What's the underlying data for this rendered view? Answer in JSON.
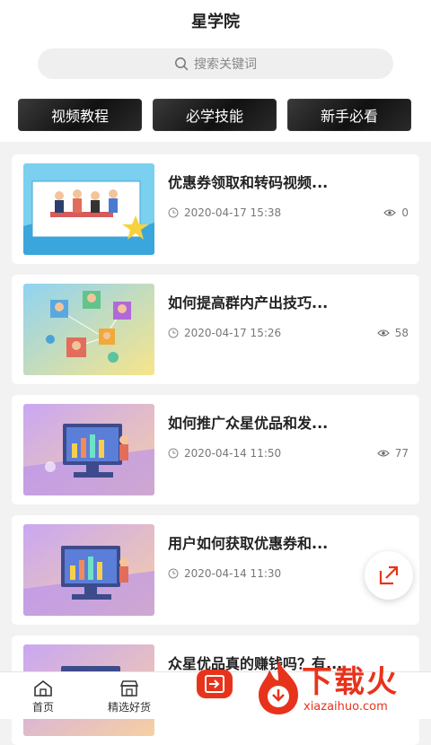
{
  "header": {
    "title": "星学院"
  },
  "search": {
    "placeholder": "搜索关键词",
    "icon": "search-icon"
  },
  "tabs": [
    {
      "label": "视频教程"
    },
    {
      "label": "必学技能"
    },
    {
      "label": "新手必看"
    }
  ],
  "articles": [
    {
      "title": "优惠券领取和转码视频...",
      "time": "2020-04-17 15:38",
      "views": "0"
    },
    {
      "title": "如何提高群内产出技巧...",
      "time": "2020-04-17 15:26",
      "views": "58"
    },
    {
      "title": "如何推广众星优品和发...",
      "time": "2020-04-14 11:50",
      "views": "77"
    },
    {
      "title": "用户如何获取优惠券和...",
      "time": "2020-04-14 11:30",
      "views": ""
    },
    {
      "title": "众星优品真的赚钱吗？有...",
      "time": "",
      "views": ""
    }
  ],
  "bottom_nav": [
    {
      "label": "首页",
      "icon": "home-icon"
    },
    {
      "label": "精选好货",
      "icon": "shop-icon"
    }
  ],
  "watermark": {
    "brand": "下载火",
    "url": "xiazaihuo.com"
  },
  "colors": {
    "accent": "#e8331c",
    "tab_bg": "#1a1a1a",
    "page_bg": "#f2f2f2"
  }
}
